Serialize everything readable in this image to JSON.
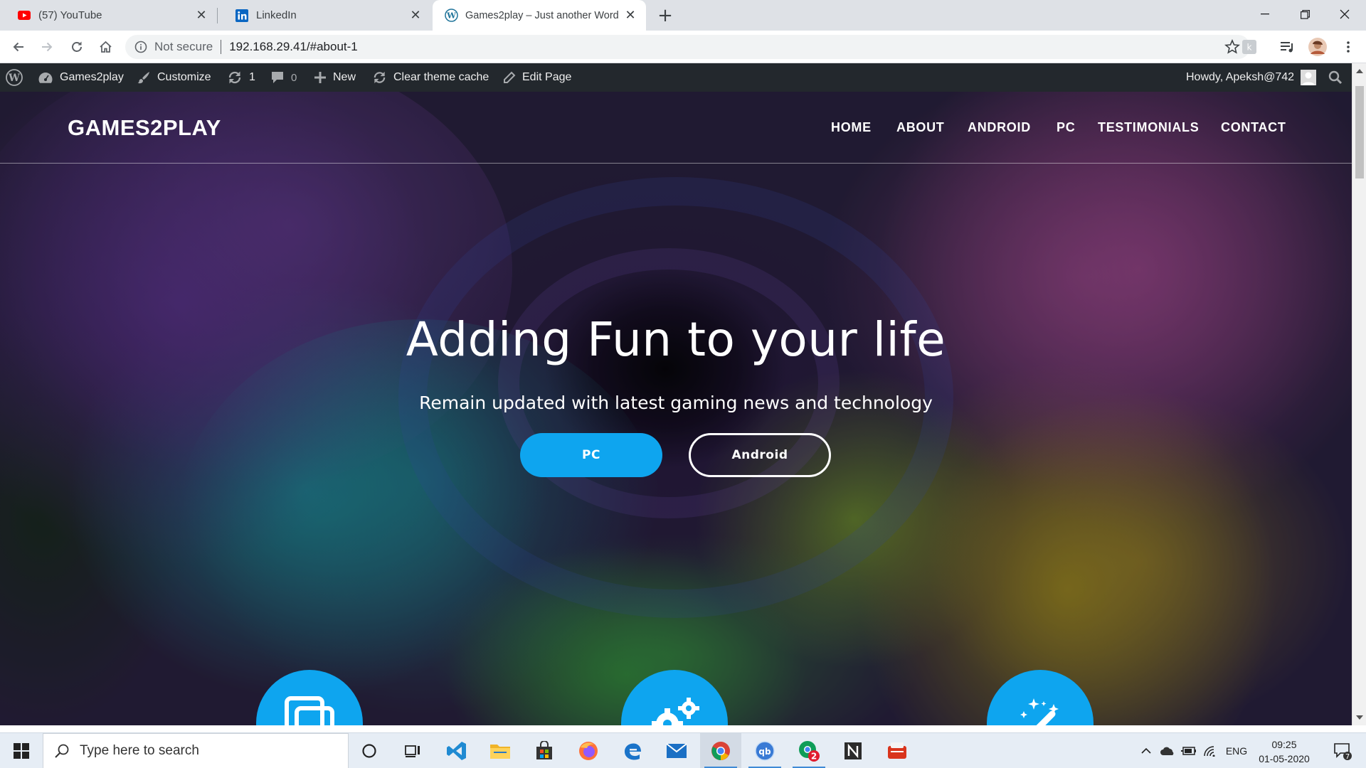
{
  "browser": {
    "tabs": [
      {
        "title": "(57) YouTube",
        "icon": "youtube-icon",
        "active": false
      },
      {
        "title": "LinkedIn",
        "icon": "linkedin-icon",
        "active": false
      },
      {
        "title": "Games2play – Just another Word",
        "icon": "wordpress-icon",
        "active": true
      }
    ],
    "new_tab": "+",
    "security_label": "Not secure",
    "url": "192.168.29.41/#about-1"
  },
  "adminbar": {
    "site_name": "Games2play",
    "customize": "Customize",
    "updates_count": "1",
    "comments_count": "0",
    "new_label": "New",
    "clear_cache": "Clear theme cache",
    "edit_page": "Edit Page",
    "howdy": "Howdy, Apeksh@742"
  },
  "site": {
    "brand": "GAMES2PLAY",
    "nav": [
      "HOME",
      "ABOUT",
      "ANDROID",
      "PC",
      "TESTIMONIALS",
      "CONTACT"
    ],
    "hero_title": "Adding Fun to your life",
    "hero_subtitle": "Remain updated with latest gaming news and technology",
    "buttons": {
      "pc": "PC",
      "android": "Android"
    },
    "feature_icons": [
      "copy-icon",
      "gears-icon",
      "magic-wand-icon"
    ]
  },
  "taskbar": {
    "search_placeholder": "Type here to search",
    "apps": [
      "cortana-icon",
      "task-view-icon",
      "vscode-icon",
      "file-explorer-icon",
      "store-icon",
      "firefox-icon",
      "edge-icon",
      "mail-icon",
      "chrome-icon",
      "qbittorrent-icon",
      "chrome-badge-icon",
      "notepad-icon",
      "app-icon"
    ],
    "chrome_badge_count": "2",
    "language": "ENG",
    "time": "09:25",
    "date": "01-05-2020",
    "notification_count": "7"
  },
  "colors": {
    "accent": "#0ea5ef",
    "adminbar": "#23282d",
    "tabstrip": "#dee1e6",
    "taskbar": "#e6edf5"
  }
}
